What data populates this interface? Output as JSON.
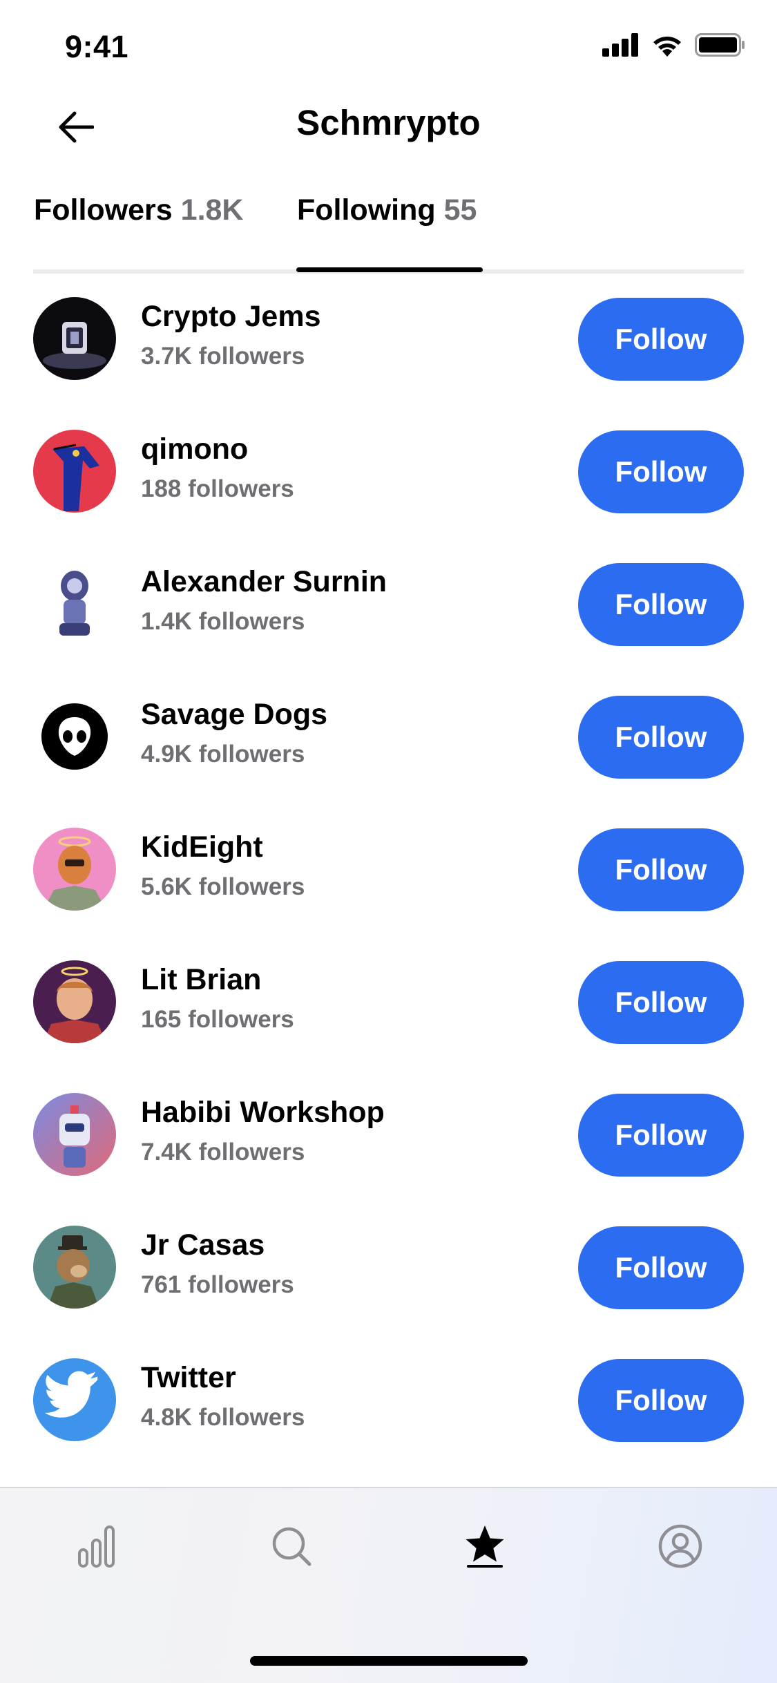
{
  "status_bar": {
    "time": "9:41"
  },
  "header": {
    "title": "Schmrypto"
  },
  "tabs": [
    {
      "label": "Followers",
      "count": "1.8K",
      "active": false
    },
    {
      "label": "Following",
      "count": "55",
      "active": true
    }
  ],
  "follow_label": "Follow",
  "accounts": [
    {
      "name": "Crypto Jems",
      "followers": "3.7K followers",
      "avatar": "crypto-jems-avatar"
    },
    {
      "name": "qimono",
      "followers": "188 followers",
      "avatar": "qimono-avatar"
    },
    {
      "name": "Alexander Surnin",
      "followers": "1.4K followers",
      "avatar": "alexander-surnin-avatar"
    },
    {
      "name": "Savage Dogs",
      "followers": "4.9K followers",
      "avatar": "savage-dogs-avatar"
    },
    {
      "name": "KidEight",
      "followers": "5.6K followers",
      "avatar": "kideight-avatar"
    },
    {
      "name": "Lit Brian",
      "followers": "165 followers",
      "avatar": "lit-brian-avatar"
    },
    {
      "name": "Habibi Workshop",
      "followers": "7.4K followers",
      "avatar": "habibi-workshop-avatar"
    },
    {
      "name": "Jr Casas",
      "followers": "761 followers",
      "avatar": "jr-casas-avatar"
    },
    {
      "name": "Twitter",
      "followers": "4.8K followers",
      "avatar": "twitter-avatar"
    }
  ],
  "bottom_nav": [
    {
      "icon": "bar-chart-icon",
      "active": false
    },
    {
      "icon": "search-icon",
      "active": false
    },
    {
      "icon": "star-icon",
      "active": true
    },
    {
      "icon": "profile-icon",
      "active": false
    }
  ],
  "colors": {
    "accent": "#2c6cf0",
    "secondary_text": "#6e6e73"
  }
}
